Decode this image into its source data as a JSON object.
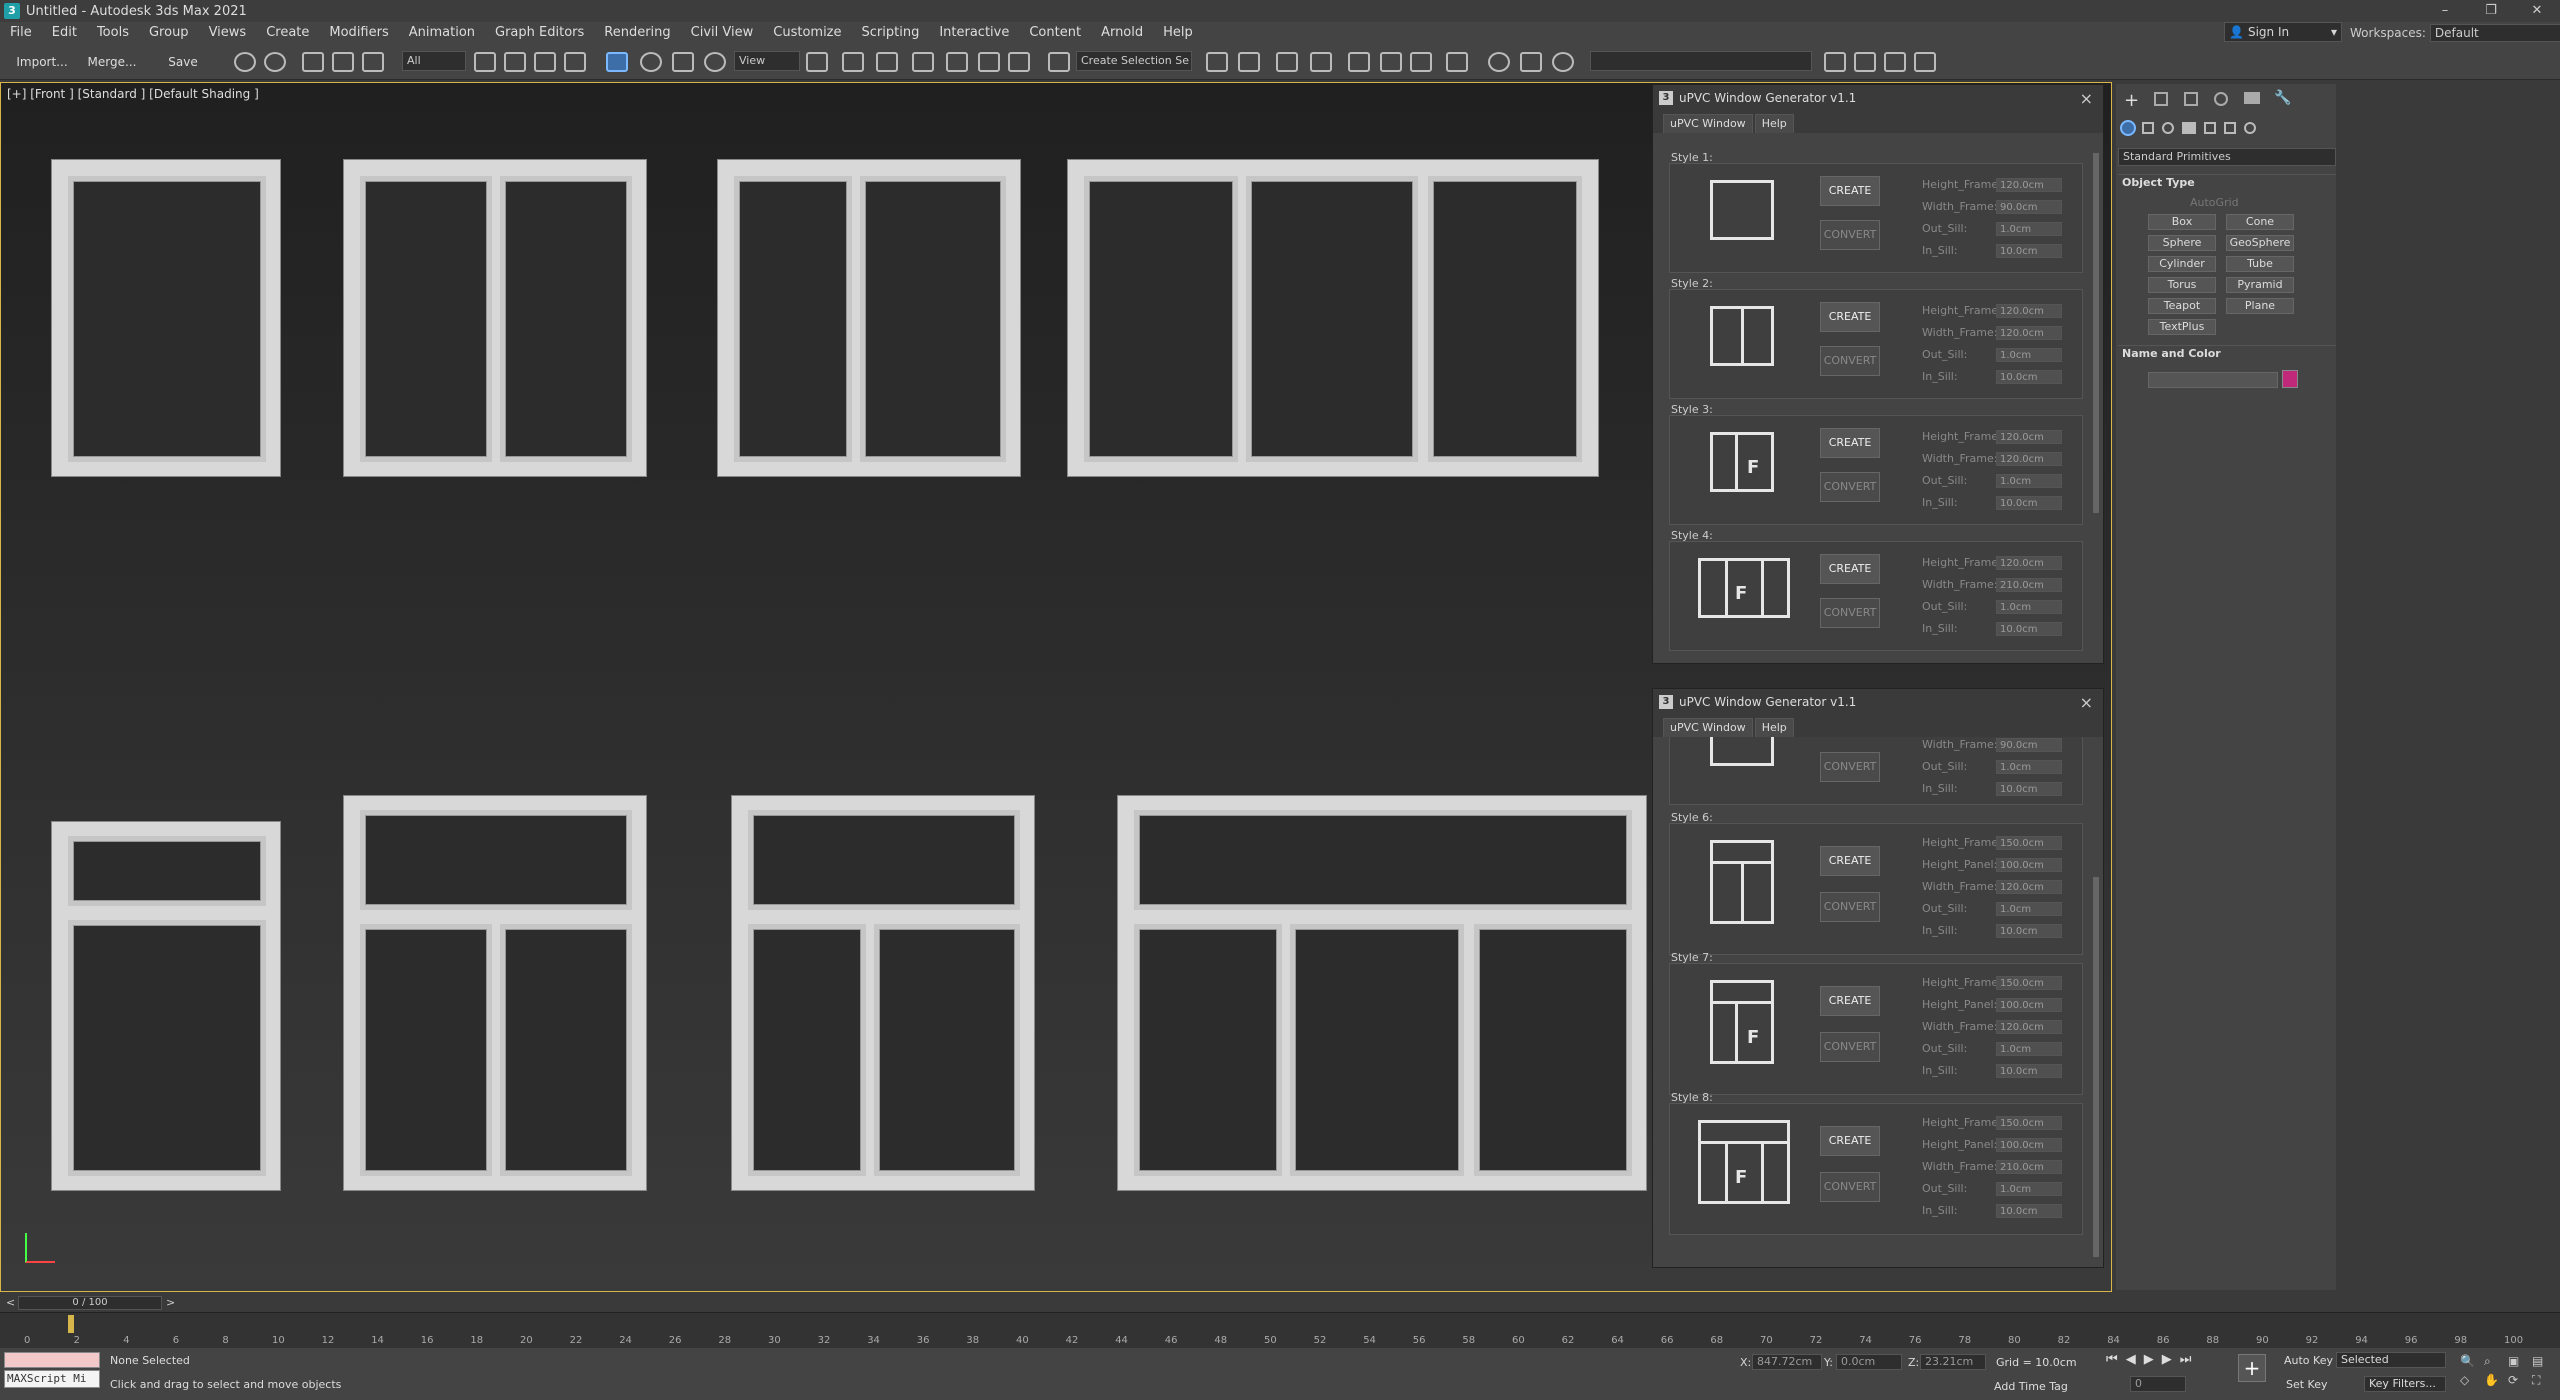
{
  "titlebar": {
    "title": "Untitled - Autodesk 3ds Max 2021",
    "icon": "3",
    "min": "–",
    "max": "❐",
    "close": "✕"
  },
  "menu": [
    "File",
    "Edit",
    "Tools",
    "Group",
    "Views",
    "Create",
    "Modifiers",
    "Animation",
    "Graph Editors",
    "Rendering",
    "Civil View",
    "Customize",
    "Scripting",
    "Interactive",
    "Content",
    "Arnold",
    "Help"
  ],
  "signin": {
    "label": "Sign In"
  },
  "workspaces": {
    "label": "Workspaces:",
    "value": "Default"
  },
  "toolbar": {
    "import": "Import...",
    "merge": "Merge...",
    "save": "Save",
    "filter": "All",
    "refcoord": "View",
    "selset": "Create Selection Se"
  },
  "viewport": {
    "label": "[+] [Front ] [Standard ] [Default Shading ]"
  },
  "panel1": {
    "title": "uPVC Window Generator v1.1",
    "icon": "3",
    "tabs": [
      "uPVC Window",
      "Help"
    ],
    "styles": [
      {
        "label": "Style 1:",
        "create": "CREATE",
        "convert": "CONVERT",
        "fields": [
          {
            "l": "Height_Frame:",
            "v": "120.0cm"
          },
          {
            "l": "Width_Frame:",
            "v": "90.0cm"
          },
          {
            "l": "Out_Sill:",
            "v": "1.0cm"
          },
          {
            "l": "In_Sill:",
            "v": "10.0cm"
          }
        ]
      },
      {
        "label": "Style 2:",
        "create": "CREATE",
        "convert": "CONVERT",
        "fields": [
          {
            "l": "Height_Frame:",
            "v": "120.0cm"
          },
          {
            "l": "Width_Frame:",
            "v": "120.0cm"
          },
          {
            "l": "Out_Sill:",
            "v": "1.0cm"
          },
          {
            "l": "In_Sill:",
            "v": "10.0cm"
          }
        ]
      },
      {
        "label": "Style 3:",
        "create": "CREATE",
        "convert": "CONVERT",
        "fields": [
          {
            "l": "Height_Frame:",
            "v": "120.0cm"
          },
          {
            "l": "Width_Frame:",
            "v": "120.0cm"
          },
          {
            "l": "Out_Sill:",
            "v": "1.0cm"
          },
          {
            "l": "In_Sill:",
            "v": "10.0cm"
          }
        ]
      },
      {
        "label": "Style 4:",
        "create": "CREATE",
        "convert": "CONVERT",
        "fields": [
          {
            "l": "Height_Frame:",
            "v": "120.0cm"
          },
          {
            "l": "Width_Frame:",
            "v": "210.0cm"
          },
          {
            "l": "Out_Sill:",
            "v": "1.0cm"
          },
          {
            "l": "In_Sill:",
            "v": "10.0cm"
          }
        ]
      }
    ]
  },
  "panel2": {
    "title": "uPVC Window Generator v1.1",
    "icon": "3",
    "tabs": [
      "uPVC Window",
      "Help"
    ],
    "partial": {
      "convert": "CONVERT",
      "fields": [
        {
          "l": "Width_Frame:",
          "v": "90.0cm"
        },
        {
          "l": "Out_Sill:",
          "v": "1.0cm"
        },
        {
          "l": "In_Sill:",
          "v": "10.0cm"
        }
      ]
    },
    "styles": [
      {
        "label": "Style 6:",
        "create": "CREATE",
        "convert": "CONVERT",
        "fields": [
          {
            "l": "Height_Frame:",
            "v": "150.0cm"
          },
          {
            "l": "Height_Panel:",
            "v": "100.0cm"
          },
          {
            "l": "Width_Frame:",
            "v": "120.0cm"
          },
          {
            "l": "Out_Sill:",
            "v": "1.0cm"
          },
          {
            "l": "In_Sill:",
            "v": "10.0cm"
          }
        ]
      },
      {
        "label": "Style 7:",
        "create": "CREATE",
        "convert": "CONVERT",
        "fields": [
          {
            "l": "Height_Frame:",
            "v": "150.0cm"
          },
          {
            "l": "Height_Panel:",
            "v": "100.0cm"
          },
          {
            "l": "Width_Frame:",
            "v": "120.0cm"
          },
          {
            "l": "Out_Sill:",
            "v": "1.0cm"
          },
          {
            "l": "In_Sill:",
            "v": "10.0cm"
          }
        ]
      },
      {
        "label": "Style 8:",
        "create": "CREATE",
        "convert": "CONVERT",
        "fields": [
          {
            "l": "Height_Frame:",
            "v": "150.0cm"
          },
          {
            "l": "Height_Panel:",
            "v": "100.0cm"
          },
          {
            "l": "Width_Frame:",
            "v": "210.0cm"
          },
          {
            "l": "Out_Sill:",
            "v": "1.0cm"
          },
          {
            "l": "In_Sill:",
            "v": "10.0cm"
          }
        ]
      }
    ]
  },
  "command": {
    "dropdown": "Standard Primitives",
    "object_type": "Object Type",
    "autogrid": "AutoGrid",
    "objects": [
      "Box",
      "Cone",
      "Sphere",
      "GeoSphere",
      "Cylinder",
      "Tube",
      "Torus",
      "Pyramid",
      "Teapot",
      "Plane",
      "TextPlus"
    ],
    "name_color": "Name and Color",
    "swatch": "#c0287a"
  },
  "timeline": {
    "slider": "0 / 100",
    "ticks": [
      "0",
      "2",
      "4",
      "6",
      "8",
      "10",
      "12",
      "14",
      "16",
      "18",
      "20",
      "22",
      "24",
      "26",
      "28",
      "30",
      "32",
      "34",
      "36",
      "38",
      "40",
      "42",
      "44",
      "46",
      "48",
      "50",
      "52",
      "54",
      "56",
      "58",
      "60",
      "62",
      "64",
      "66",
      "68",
      "70",
      "72",
      "74",
      "76",
      "78",
      "80",
      "82",
      "84",
      "86",
      "88",
      "90",
      "92",
      "94",
      "96",
      "98",
      "100"
    ]
  },
  "status": {
    "maxscript": "MAXScript Mi",
    "selected": "None Selected",
    "hint": "Click and drag to select and move objects",
    "x_label": "X:",
    "x": "847.72cm",
    "y_label": "Y:",
    "y": "0.0cm",
    "z_label": "Z:",
    "z": "23.21cm",
    "grid": "Grid = 10.0cm",
    "timetag": "Add Time Tag",
    "autokey": "Auto Key",
    "setkey": "Set Key",
    "selected_dd": "Selected",
    "keyfilters": "Key Filters...",
    "frame": "0"
  }
}
